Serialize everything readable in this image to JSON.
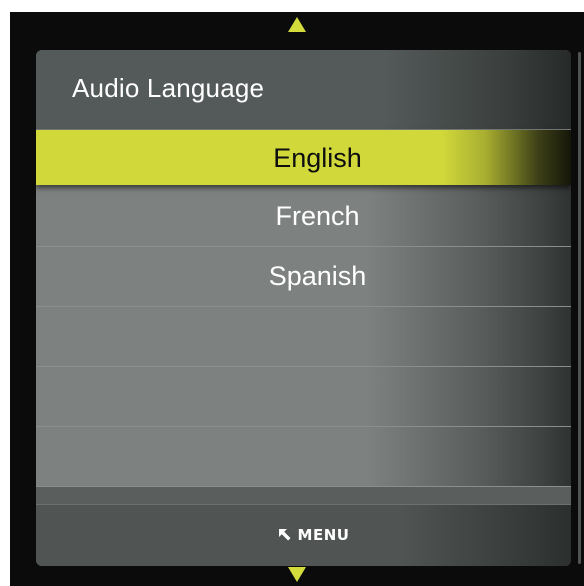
{
  "window": {
    "title": "Audio Language"
  },
  "navigation": {
    "up_icon": "up-arrow-icon",
    "down_icon": "down-arrow-icon"
  },
  "options": [
    {
      "label": "English",
      "selected": true
    },
    {
      "label": "French",
      "selected": false
    },
    {
      "label": "Spanish",
      "selected": false
    },
    {
      "label": "",
      "selected": false
    },
    {
      "label": "",
      "selected": false
    },
    {
      "label": "",
      "selected": false
    }
  ],
  "footer": {
    "menu_label": "MENU",
    "menu_icon": "back-arrow-icon"
  },
  "colors": {
    "accent": "#d0d83a",
    "panel": "#545a59",
    "row": "#7d817f",
    "background": "#0b0b0b"
  }
}
